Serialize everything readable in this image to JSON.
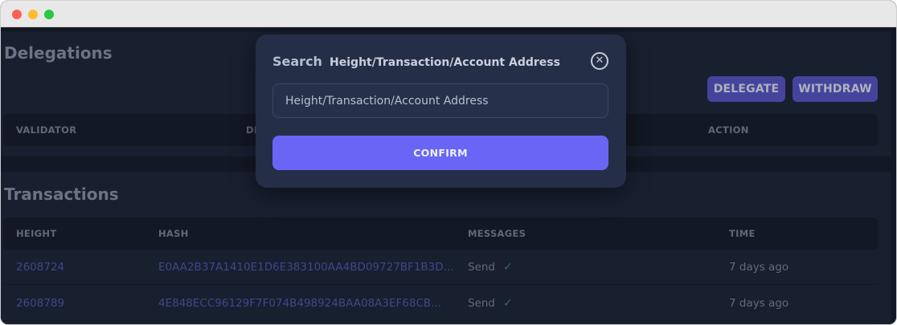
{
  "delegations": {
    "title": "Delegations",
    "buttons": {
      "delegate": "DELEGATE",
      "withdraw": "WITHDRAW"
    },
    "columns": [
      "VALIDATOR",
      "DE",
      "ACTION"
    ]
  },
  "transactions": {
    "title": "Transactions",
    "columns": [
      "HEIGHT",
      "HASH",
      "MESSAGES",
      "TIME"
    ],
    "rows": [
      {
        "height": "2608724",
        "hash": "E0AA2B37A1410E1D6E383100AA4BD09727BF1B3D...",
        "message": "Send",
        "time": "7 days ago"
      },
      {
        "height": "2608789",
        "hash": "4E848ECC96129F7F074B498924BAA08A3EF68CB...",
        "message": "Send",
        "time": "7 days ago"
      }
    ]
  },
  "search_modal": {
    "title": "Search",
    "subtitle": "Height/Transaction/Account Address",
    "input_placeholder": "Height/Transaction/Account Address",
    "close_symbol": "✕",
    "confirm_label": "CONFIRM"
  },
  "icons": {
    "check": "✓"
  },
  "colors": {
    "accent": "#6a65f5",
    "button": "#5856c9",
    "link": "#4d5bb0",
    "success": "#3d8f5c",
    "background": "#151b29"
  }
}
